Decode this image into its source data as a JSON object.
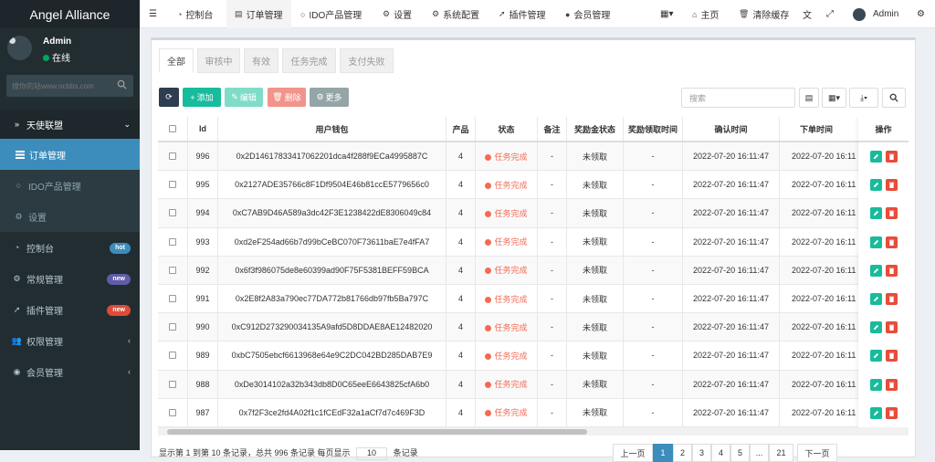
{
  "app": {
    "title": "Angel Alliance"
  },
  "user": {
    "name": "Admin",
    "status": "在线"
  },
  "sidebar": {
    "search_placeholder": "搜你的站www.ocbbs.com",
    "items": [
      {
        "label": "天使联盟",
        "icon": "chevron-right-icon"
      },
      {
        "label": "订单管理",
        "icon": "list-icon"
      },
      {
        "label": "IDO产品管理",
        "icon": "circle-icon"
      },
      {
        "label": "设置",
        "icon": "gear-icon"
      },
      {
        "label": "控制台",
        "icon": "dashboard-icon",
        "badge": "hot"
      },
      {
        "label": "常规管理",
        "icon": "cogs-icon",
        "badge": "new"
      },
      {
        "label": "插件管理",
        "icon": "rocket-icon",
        "badge": "new"
      },
      {
        "label": "权限管理",
        "icon": "users-icon"
      },
      {
        "label": "会员管理",
        "icon": "user-circle-icon"
      }
    ]
  },
  "topbar": {
    "items": [
      "控制台",
      "订单管理",
      "IDO产品管理",
      "设置",
      "系统配置",
      "插件管理",
      "会员管理"
    ],
    "right": [
      "主页",
      "清除缓存",
      "Admin"
    ]
  },
  "tabs": [
    "全部",
    "审核中",
    "有效",
    "任务完成",
    "支付失败"
  ],
  "toolbar": {
    "add": "添加",
    "edit": "编辑",
    "del": "删除",
    "more": "更多",
    "search_placeholder": "搜索"
  },
  "table": {
    "headers": [
      "Id",
      "用户钱包",
      "产品",
      "状态",
      "备注",
      "奖励金状态",
      "奖励领取时间",
      "确认时间",
      "下单时间",
      "操作"
    ],
    "rows": [
      {
        "id": "996",
        "wallet": "0x2D14617833417062201dca4f288f9ECa4995887C",
        "product": "4",
        "status": "任务完成",
        "note": "-",
        "reward": "未领取",
        "reward_time": "-",
        "confirm": "2022-07-20 16:11:47",
        "order": "2022-07-20 16:11"
      },
      {
        "id": "995",
        "wallet": "0x2127ADE35766c8F1Df9504E46b81ccE5779656c0",
        "product": "4",
        "status": "任务完成",
        "note": "-",
        "reward": "未领取",
        "reward_time": "-",
        "confirm": "2022-07-20 16:11:47",
        "order": "2022-07-20 16:11"
      },
      {
        "id": "994",
        "wallet": "0xC7AB9D46A589a3dc42F3E1238422dE8306049c84",
        "product": "4",
        "status": "任务完成",
        "note": "-",
        "reward": "未领取",
        "reward_time": "-",
        "confirm": "2022-07-20 16:11:47",
        "order": "2022-07-20 16:11"
      },
      {
        "id": "993",
        "wallet": "0xd2eF254ad66b7d99bCeBC070F73611baE7e4fFA7",
        "product": "4",
        "status": "任务完成",
        "note": "-",
        "reward": "未领取",
        "reward_time": "-",
        "confirm": "2022-07-20 16:11:47",
        "order": "2022-07-20 16:11"
      },
      {
        "id": "992",
        "wallet": "0x6f3f986075de8e60399ad90F75F5381BEFF59BCA",
        "product": "4",
        "status": "任务完成",
        "note": "-",
        "reward": "未领取",
        "reward_time": "-",
        "confirm": "2022-07-20 16:11:47",
        "order": "2022-07-20 16:11"
      },
      {
        "id": "991",
        "wallet": "0x2E8f2A83a790ec77DA772b81766db97fb5Ba797C",
        "product": "4",
        "status": "任务完成",
        "note": "-",
        "reward": "未领取",
        "reward_time": "-",
        "confirm": "2022-07-20 16:11:47",
        "order": "2022-07-20 16:11"
      },
      {
        "id": "990",
        "wallet": "0xC912D273290034135A9afd5D8DDAE8AE12482020",
        "product": "4",
        "status": "任务完成",
        "note": "-",
        "reward": "未领取",
        "reward_time": "-",
        "confirm": "2022-07-20 16:11:47",
        "order": "2022-07-20 16:11"
      },
      {
        "id": "989",
        "wallet": "0xbC7505ebcf6613968e64e9C2DC042BD285DAB7E9",
        "product": "4",
        "status": "任务完成",
        "note": "-",
        "reward": "未领取",
        "reward_time": "-",
        "confirm": "2022-07-20 16:11:47",
        "order": "2022-07-20 16:11"
      },
      {
        "id": "988",
        "wallet": "0xDe3014102a32b343db8D0C65eeE6643825cfA6b0",
        "product": "4",
        "status": "任务完成",
        "note": "-",
        "reward": "未领取",
        "reward_time": "-",
        "confirm": "2022-07-20 16:11:47",
        "order": "2022-07-20 16:11"
      },
      {
        "id": "987",
        "wallet": "0x7f2F3ce2fd4A02f1c1fCEdF32a1aCf7d7c469F3D",
        "product": "4",
        "status": "任务完成",
        "note": "-",
        "reward": "未领取",
        "reward_time": "-",
        "confirm": "2022-07-20 16:11:47",
        "order": "2022-07-20 16:11"
      }
    ]
  },
  "footer": {
    "text": "显示第 1 到第 10 条记录，总共 996 条记录 每页显示",
    "per_page": "10",
    "suffix": "条记录"
  },
  "pagination": [
    "上一页",
    "1",
    "2",
    "3",
    "4",
    "5",
    "...",
    "21",
    "下一页"
  ],
  "colors": {
    "accent": "#3c8dbc",
    "sidebar": "#222d32",
    "add": "#18bc9c",
    "danger": "#e74c3c"
  }
}
